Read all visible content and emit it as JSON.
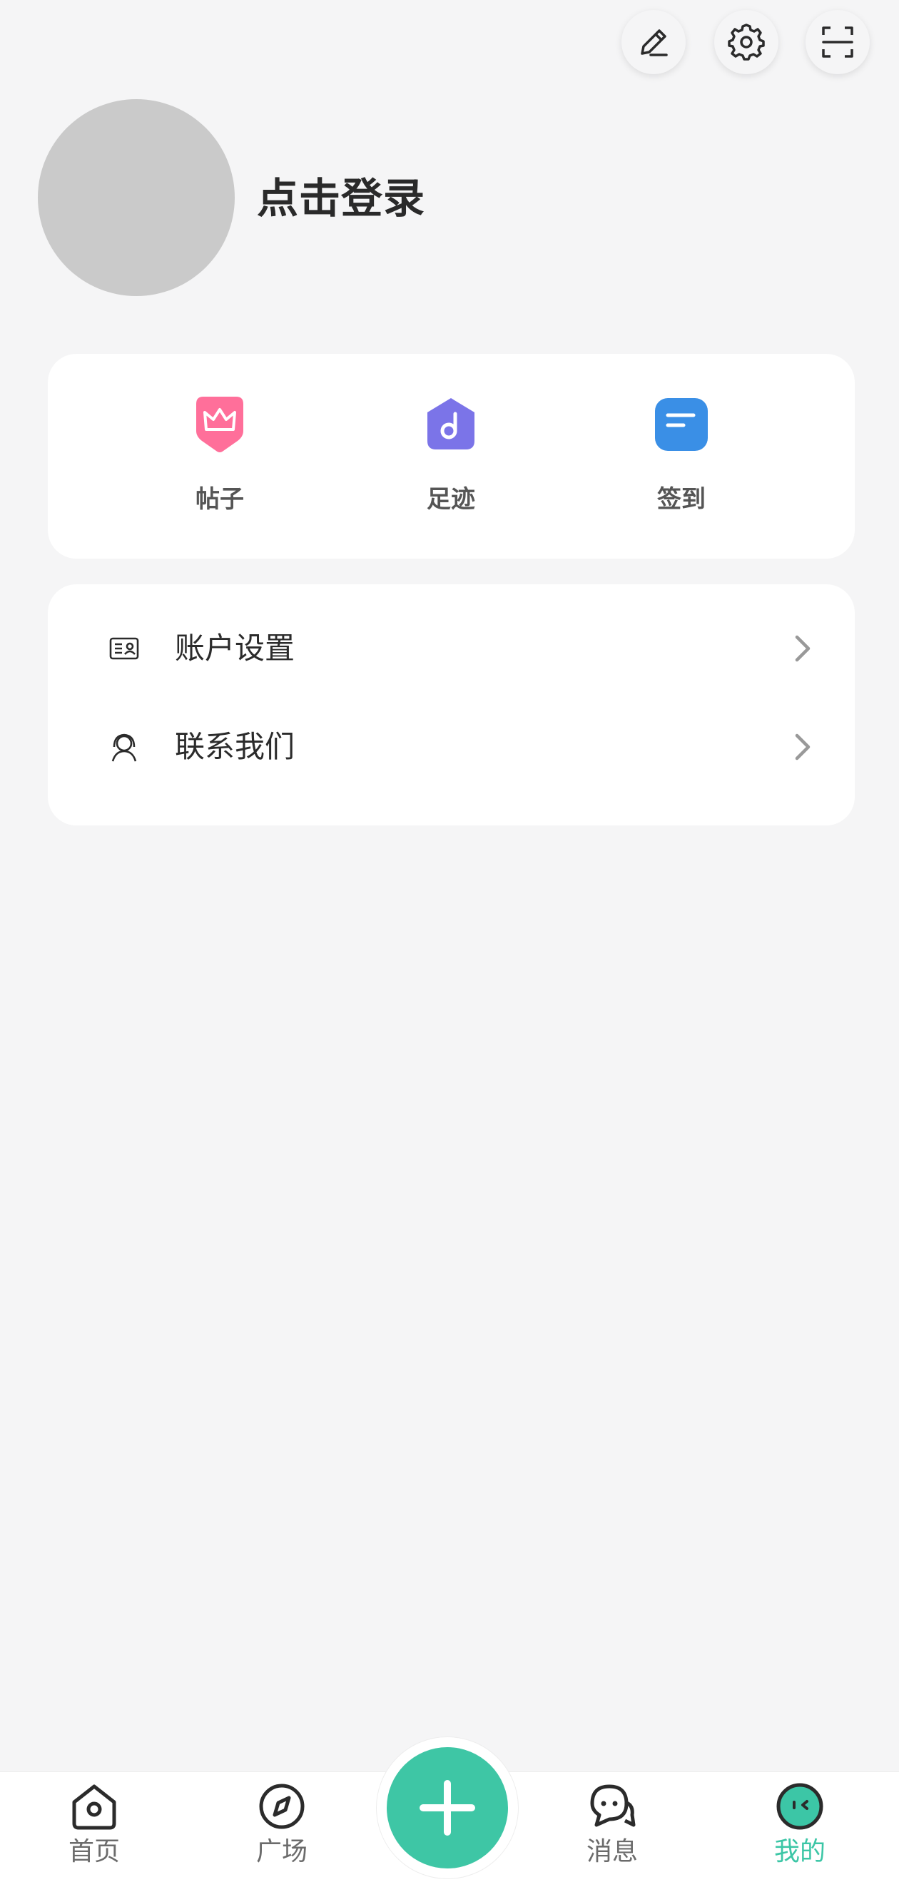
{
  "header": {
    "actions": [
      {
        "name": "edit",
        "icon": "pencil-icon"
      },
      {
        "name": "settings",
        "icon": "gear-icon"
      },
      {
        "name": "scan",
        "icon": "scan-icon"
      }
    ]
  },
  "profile": {
    "login_label": "点击登录"
  },
  "quick_actions": [
    {
      "label": "帖子",
      "icon": "crown-icon",
      "color": "#ff6f9a"
    },
    {
      "label": "足迹",
      "icon": "music-note-icon",
      "color": "#7b74e8"
    },
    {
      "label": "签到",
      "icon": "document-icon",
      "color": "#3a8fe6"
    }
  ],
  "menu": [
    {
      "label": "账户设置",
      "icon": "id-card-icon"
    },
    {
      "label": "联系我们",
      "icon": "customer-service-icon"
    }
  ],
  "bottom_nav": {
    "items": [
      {
        "label": "首页",
        "icon": "home-icon",
        "active": false
      },
      {
        "label": "广场",
        "icon": "compass-icon",
        "active": false
      },
      {
        "label": "消息",
        "icon": "chat-icon",
        "active": false
      },
      {
        "label": "我的",
        "icon": "face-icon",
        "active": true
      }
    ],
    "publish_icon": "plus-icon"
  },
  "colors": {
    "accent": "#3ec6a5",
    "background": "#f5f5f6",
    "avatar_placeholder": "#cacaca"
  }
}
